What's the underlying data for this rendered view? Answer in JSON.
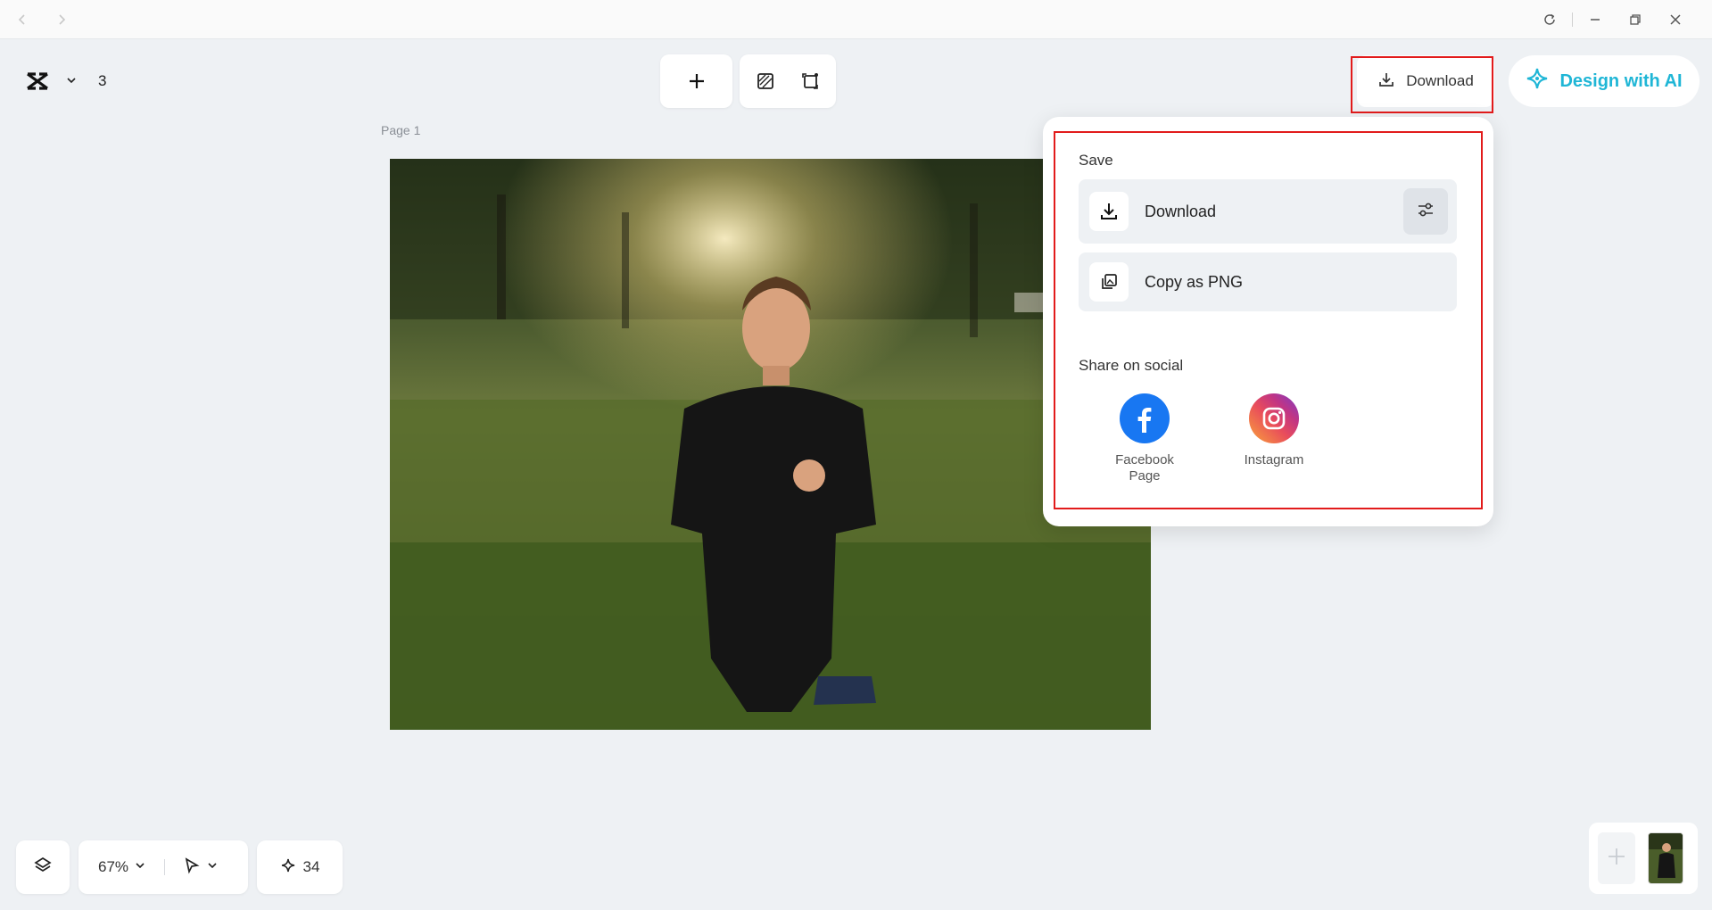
{
  "toolbar": {
    "page_count": "3"
  },
  "header": {
    "download_label": "Download",
    "design_ai_label": "Design with AI"
  },
  "canvas": {
    "page_label": "Page 1"
  },
  "download_panel": {
    "save_title": "Save",
    "download_option": "Download",
    "copy_option": "Copy as PNG",
    "share_title": "Share on social",
    "socials": [
      {
        "name_line1": "Facebook",
        "name_line2": "Page"
      },
      {
        "name_line1": "Instagram",
        "name_line2": ""
      }
    ]
  },
  "bottom_bar": {
    "zoom": "67%",
    "credits": "34"
  },
  "colors": {
    "accent": "#1fb6d6",
    "facebook": "#1877f2",
    "highlight": "#e21b1b"
  }
}
